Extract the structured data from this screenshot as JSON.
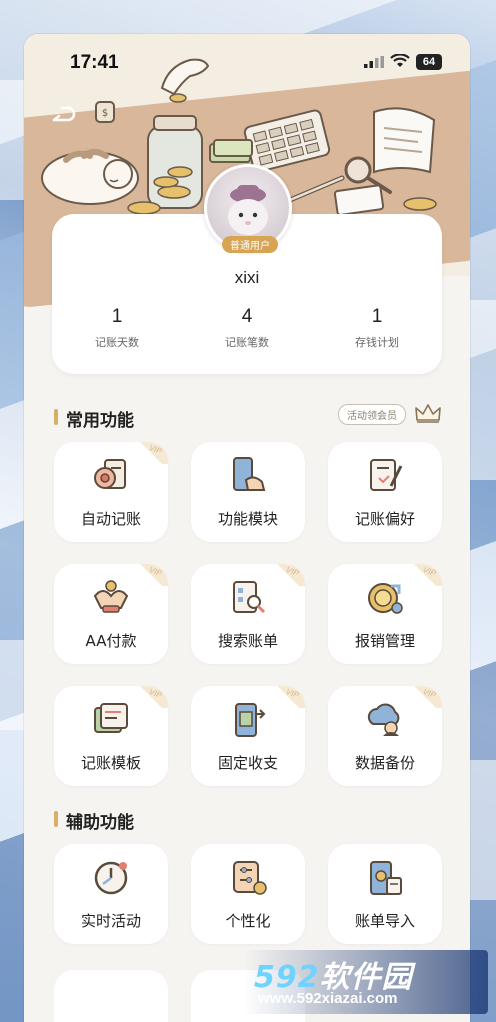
{
  "status_bar": {
    "time": "17:41",
    "battery": "64"
  },
  "profile": {
    "badge": "普通用户",
    "username": "xixi",
    "stats": [
      {
        "value": "1",
        "label": "记账天数"
      },
      {
        "value": "4",
        "label": "记账笔数"
      },
      {
        "value": "1",
        "label": "存钱计划"
      }
    ]
  },
  "common": {
    "title": "常用功能",
    "vip_pill": "活动领会员",
    "vip_tag": "VIP",
    "items": [
      {
        "label": "自动记账",
        "icon": "auto-bookkeeping-icon",
        "vip": true
      },
      {
        "label": "功能模块",
        "icon": "function-module-icon",
        "vip": false
      },
      {
        "label": "记账偏好",
        "icon": "bookkeeping-preference-icon",
        "vip": false
      },
      {
        "label": "AA付款",
        "icon": "aa-payment-icon",
        "vip": true
      },
      {
        "label": "搜索账单",
        "icon": "search-bill-icon",
        "vip": true
      },
      {
        "label": "报销管理",
        "icon": "reimbursement-icon",
        "vip": true
      },
      {
        "label": "记账模板",
        "icon": "template-icon",
        "vip": true
      },
      {
        "label": "固定收支",
        "icon": "fixed-income-expense-icon",
        "vip": true
      },
      {
        "label": "数据备份",
        "icon": "data-backup-icon",
        "vip": true
      }
    ]
  },
  "auxiliary": {
    "title": "辅助功能",
    "items": [
      {
        "label": "实时活动",
        "icon": "live-activity-icon"
      },
      {
        "label": "个性化",
        "icon": "personalization-icon"
      },
      {
        "label": "账单导入",
        "icon": "bill-import-icon"
      }
    ]
  },
  "watermark": {
    "brand_num": "592",
    "brand_text": "软件园",
    "url": "www.592xiazai.com"
  },
  "colors": {
    "accent": "#d8ad66",
    "table": "#d8b79a",
    "card": "#ffffff",
    "page": "#f6f4f1"
  }
}
